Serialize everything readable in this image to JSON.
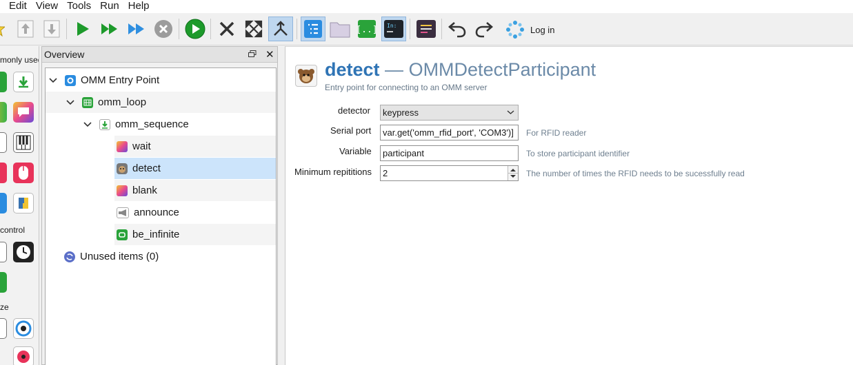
{
  "menu": [
    "Edit",
    "View",
    "Tools",
    "Run",
    "Help"
  ],
  "toolbar": {
    "login_label": "Log in"
  },
  "left_panel": {
    "headers": [
      "monly used",
      "control",
      "ze"
    ]
  },
  "overview": {
    "title": "Overview",
    "tree": [
      {
        "label": "OMM Entry Point",
        "icon": "omm-icon",
        "depth": 0,
        "expanded": true
      },
      {
        "label": "omm_loop",
        "icon": "loop-icon",
        "depth": 1,
        "expanded": true
      },
      {
        "label": "omm_sequence",
        "icon": "sequence-icon",
        "depth": 2,
        "expanded": true
      },
      {
        "label": "wait",
        "icon": "sketchpad-icon",
        "depth": 3
      },
      {
        "label": "detect",
        "icon": "participant-icon",
        "depth": 3,
        "selected": true
      },
      {
        "label": "blank",
        "icon": "sketchpad-icon",
        "depth": 3
      },
      {
        "label": "announce",
        "icon": "megaphone-icon",
        "depth": 3
      },
      {
        "label": "be_infinite",
        "icon": "infinite-icon",
        "depth": 3
      },
      {
        "label": "Unused items (0)",
        "icon": "recycle-icon",
        "depth": 0
      }
    ]
  },
  "editor": {
    "item_name": "detect",
    "item_type": "OMMDetectParticipant",
    "dash": "—",
    "description": "Entry point for connecting to an OMM server",
    "fields": {
      "detector": {
        "label": "detector",
        "value": "keypress"
      },
      "serial_port": {
        "label": "Serial port",
        "value": "var.get('omm_rfid_port', 'COM3')]",
        "hint": "For RFID reader"
      },
      "variable": {
        "label": "Variable",
        "value": "participant",
        "hint": "To store participant identifier"
      },
      "min_reps": {
        "label": "Minimum repititions",
        "value": "2",
        "hint": "The number of times the RFID needs to be sucessfully read"
      }
    }
  }
}
